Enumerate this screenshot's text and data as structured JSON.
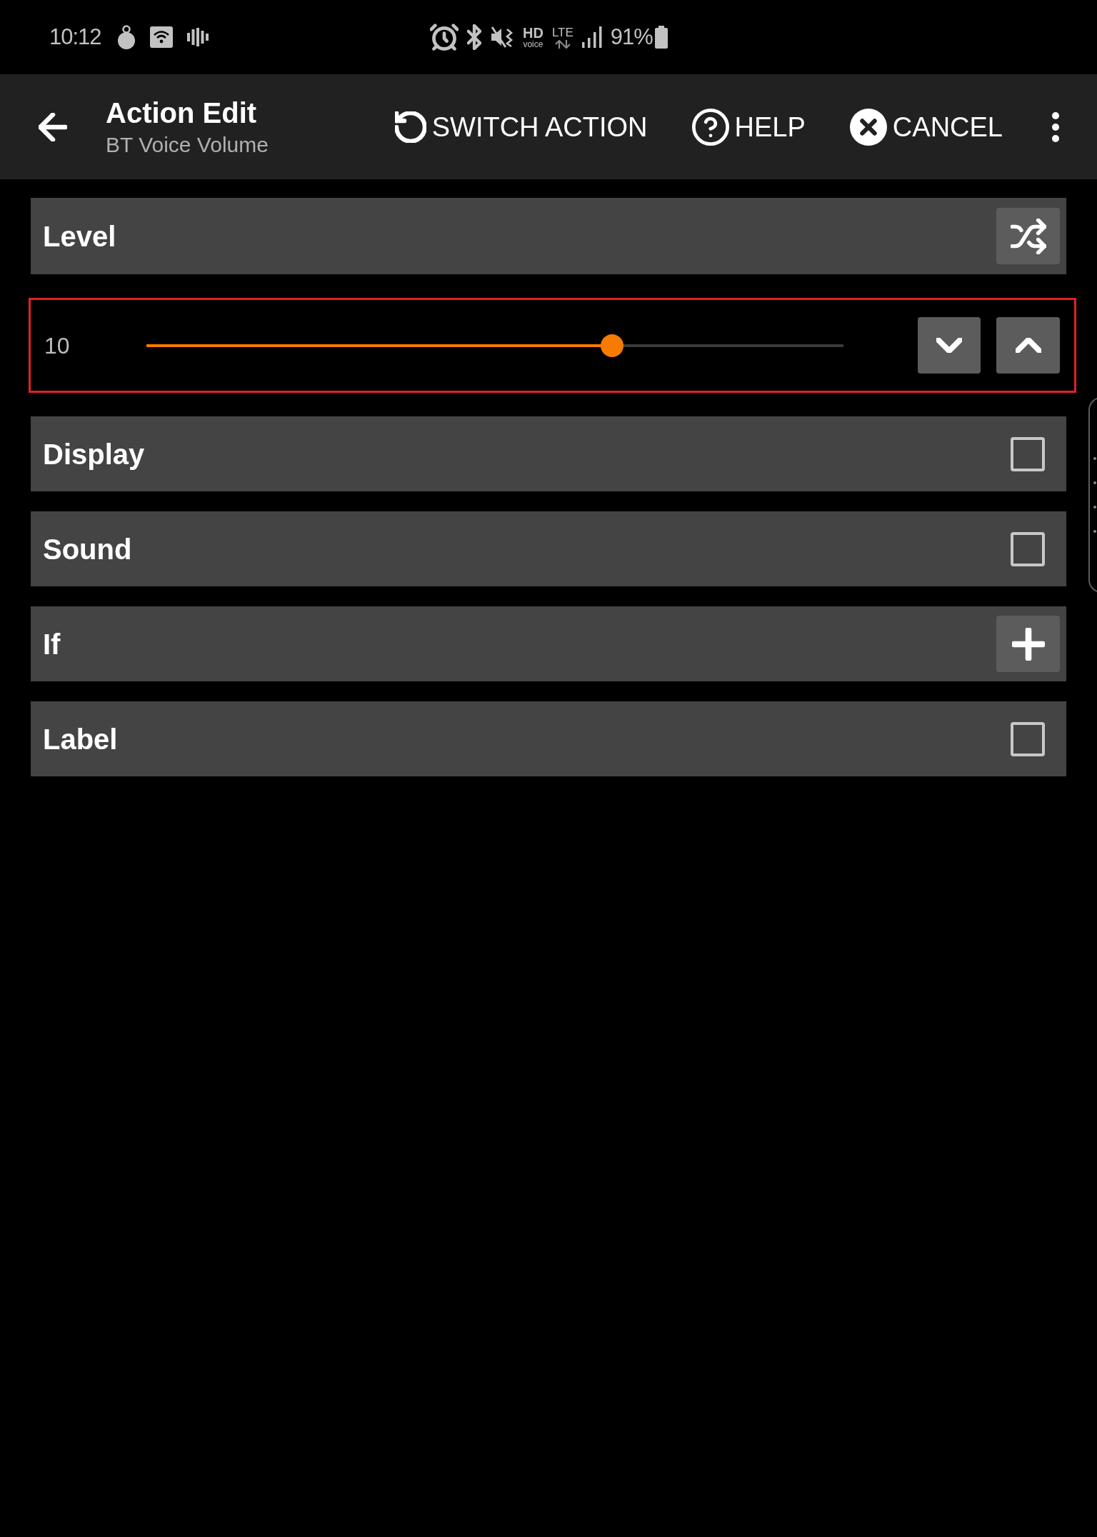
{
  "status_bar": {
    "time": "10:12",
    "hd_label": "HD",
    "hd_sublabel": "voice",
    "network": "LTE",
    "battery": "91%"
  },
  "toolbar": {
    "title": "Action Edit",
    "subtitle": "BT Voice Volume",
    "actions": [
      {
        "kind": "switch",
        "label": "SWITCH ACTION"
      },
      {
        "kind": "help",
        "label": "HELP"
      },
      {
        "kind": "cancel",
        "label": "CANCEL"
      }
    ]
  },
  "fields": [
    {
      "kind": "header",
      "label": "Level"
    },
    {
      "kind": "slider",
      "value": "10",
      "level": 0.668,
      "highlighted": true
    },
    {
      "kind": "checkbox",
      "label": "Display",
      "checked": false
    },
    {
      "kind": "checkbox",
      "label": "Sound",
      "checked": false
    },
    {
      "kind": "add",
      "label": "If"
    },
    {
      "kind": "checkbox",
      "label": "Label",
      "checked": false
    }
  ]
}
